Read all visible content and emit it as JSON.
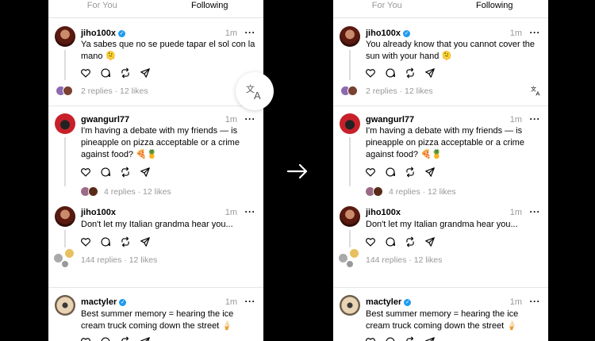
{
  "tabs": {
    "for_you": "For You",
    "following": "Following"
  },
  "left": {
    "posts": [
      {
        "user": "jiho100x",
        "verified": true,
        "time": "1m",
        "text": "Ya sabes que no se puede tapar el sol con la mano 🫠",
        "replies": "2 replies",
        "likes": "12 likes"
      },
      {
        "user": "gwangurl77",
        "verified": false,
        "time": "1m",
        "text": "I'm having a debate with my friends — is pineapple on pizza acceptable or a crime against food? 🍕🍍",
        "replies": "4 replies",
        "likes": "12 likes"
      },
      {
        "user": "jiho100x",
        "verified": false,
        "time": "1m",
        "text": "Don't let my Italian grandma hear you...",
        "replies": "144 replies",
        "likes": "12 likes"
      },
      {
        "user": "mactyler",
        "verified": true,
        "time": "1m",
        "text": "Best summer memory = hearing the ice cream truck coming down the street 🍦"
      }
    ]
  },
  "right": {
    "posts": [
      {
        "user": "jiho100x",
        "verified": true,
        "time": "1m",
        "text": "You already know that you cannot cover the sun with your hand 🫠",
        "replies": "2 replies",
        "likes": "12 likes"
      },
      {
        "user": "gwangurl77",
        "verified": false,
        "time": "1m",
        "text": "I'm having a debate with my friends — is pineapple on pizza acceptable or a crime against food? 🍕🍍",
        "replies": "4 replies",
        "likes": "12 likes"
      },
      {
        "user": "jiho100x",
        "verified": false,
        "time": "1m",
        "text": "Don't let my Italian grandma hear you...",
        "replies": "144 replies",
        "likes": "12 likes"
      },
      {
        "user": "mactyler",
        "verified": true,
        "time": "1m",
        "text": "Best summer memory = hearing the ice cream truck coming down the street 🍦"
      }
    ]
  },
  "icons": [
    "heart-icon",
    "comment-icon",
    "repost-icon",
    "share-icon",
    "translate-icon",
    "arrow-right-icon",
    "more-icon",
    "verified-badge-icon"
  ],
  "colors": {
    "verified": "#1d9bf0",
    "muted": "#999999",
    "background": "#000000"
  }
}
